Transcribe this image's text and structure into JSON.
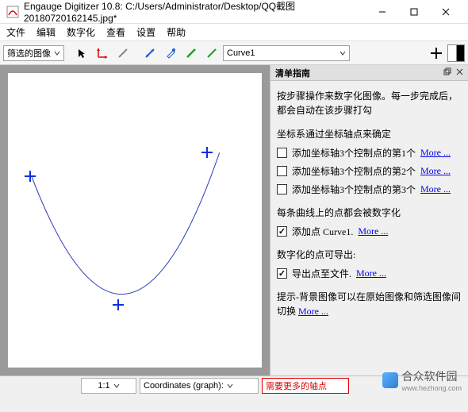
{
  "window": {
    "title": "Engauge Digitizer 10.8: C:/Users/Administrator/Desktop/QQ截图20180720162145.jpg*"
  },
  "menu": {
    "file": "文件",
    "edit": "编辑",
    "digitize": "数字化",
    "view": "查看",
    "settings": "设置",
    "help": "帮助"
  },
  "toolbar": {
    "filter_combo": "筛选的图像",
    "curve_combo": "Curve1"
  },
  "guide": {
    "title": "清单指南",
    "intro": "按步骤操作来数字化图像。每一步完成后，都会自动在该步骤打勾",
    "sect1": "坐标系通过坐标轴点来确定",
    "axis1": "添加坐标轴3个控制点的第1个",
    "axis2": "添加坐标轴3个控制点的第2个",
    "axis3": "添加坐标轴3个控制点的第3个",
    "more": "More ...",
    "sect2": "每条曲线上的点都会被数字化",
    "curve_add": "添加点 Curve1.",
    "sect3": "数字化的点可导出:",
    "export": "导出点至文件.",
    "tip_label": "提示-背景图像可以在原始图像和筛选图像间切换"
  },
  "status": {
    "zoom": "1:1",
    "coords": "Coordinates (graph):",
    "need": "需要更多的轴点"
  },
  "watermark": {
    "text": "合众软件园",
    "url": "www.hezhong.com"
  }
}
